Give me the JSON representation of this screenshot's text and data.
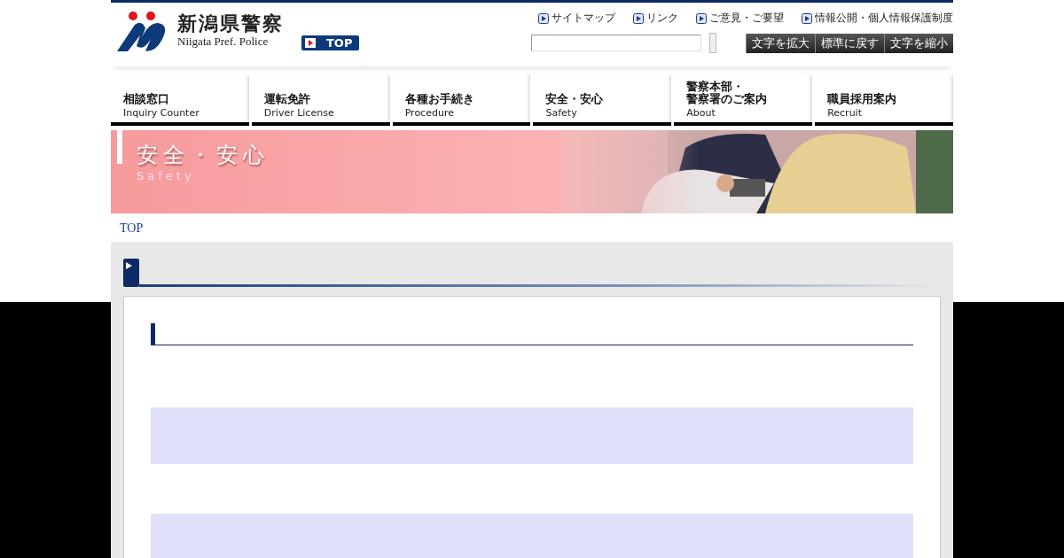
{
  "header": {
    "site_name": "新潟県警察",
    "site_name_en": "Niigata Pref. Police",
    "top_button": "TOP",
    "utility_links": [
      "サイトマップ",
      "リンク",
      "ご意見・ご要望",
      "情報公開・個人情報保護制度"
    ],
    "font_size_buttons": [
      "文字を拡大",
      "標準に戻す",
      "文字を縮小"
    ]
  },
  "nav": [
    {
      "label": "相談窓口",
      "label_en": "Inquiry Counter"
    },
    {
      "label": "運転免許",
      "label_en": "Driver License"
    },
    {
      "label": "各種お手続き",
      "label_en": "Procedure"
    },
    {
      "label": "安全・安心",
      "label_en": "Safety"
    },
    {
      "label": "警察本部・",
      "label_2": "警察署のご案内",
      "label_en": "About"
    },
    {
      "label": "職員採用案内",
      "label_en": "Recruit"
    }
  ],
  "banner": {
    "title": "安全・安心",
    "subtitle": "Safety"
  },
  "breadcrumb": [
    "TOP"
  ]
}
